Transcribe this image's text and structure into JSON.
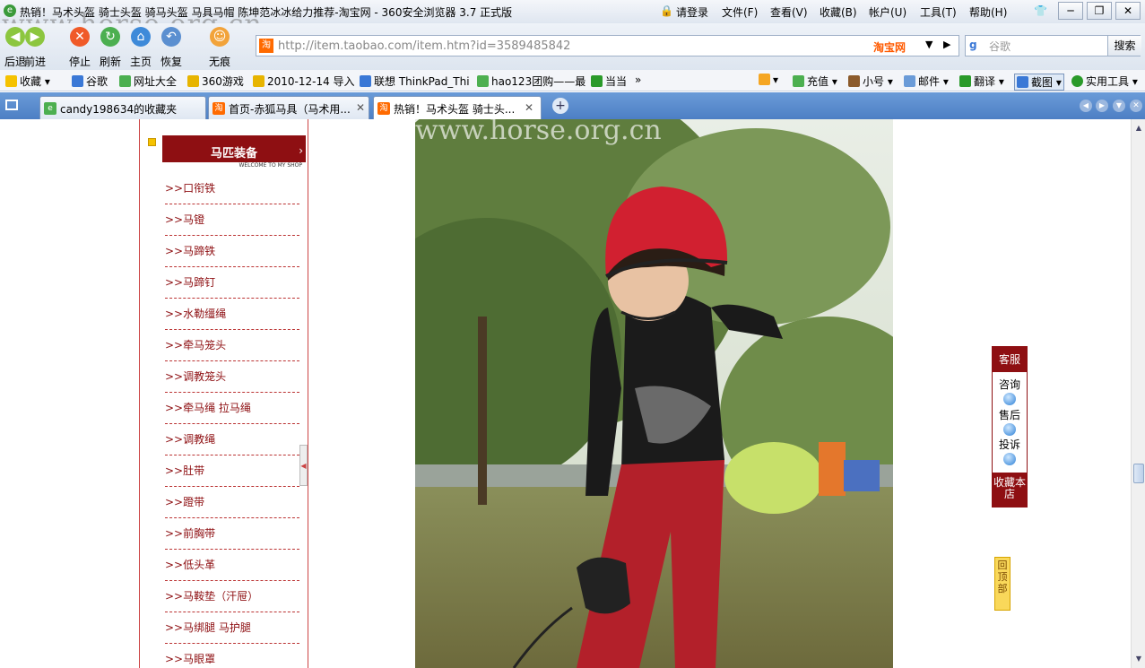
{
  "window": {
    "title": "热销！马术头盔 骑士头盔 骑马头盔 马具马帽 陈坤范冰冰给力推荐-淘宝网 - 360安全浏览器 3.7 正式版",
    "watermark": "www.horse.org.cn",
    "menu": [
      "请登录",
      "文件(F)",
      "查看(V)",
      "收藏(B)",
      "帐户(U)",
      "工具(T)",
      "帮助(H)"
    ]
  },
  "toolbar": {
    "buttons": [
      "后退",
      "前进",
      "停止",
      "刷新",
      "主页",
      "恢复",
      "无痕"
    ],
    "address": "http://item.taobao.com/item.htm?id=3589485842",
    "address_brand": "淘宝网",
    "search_placeholder": "谷歌",
    "search_button": "搜索"
  },
  "bookmarks": [
    "收藏",
    "谷歌",
    "网址大全",
    "360游戏",
    "2010-12-14 导入",
    "联想 ThinkPad_Thi",
    "hao123团购——最",
    "当当"
  ],
  "bookmarks_right": [
    "充值",
    "小号",
    "邮件",
    "翻译",
    "截图",
    "实用工具"
  ],
  "tabs": [
    {
      "label": "candy198634的收藏夹",
      "active": false
    },
    {
      "label": "首页-赤狐马具（马术用...",
      "active": false
    },
    {
      "label": "热销！马术头盔 骑士头...",
      "active": true
    }
  ],
  "sidebar": {
    "header_title": "马匹装备",
    "header_sub": "WELCOME TO MY SHOP",
    "items": [
      "口衔铁",
      "马镫",
      "马蹄铁",
      "马蹄钉",
      "水勒缰绳",
      "牵马笼头",
      "调教笼头",
      "牵马绳 拉马绳",
      "调教绳",
      "肚带",
      "蹬带",
      "前胸带",
      "低头革",
      "马鞍垫（汗屉）",
      "马绑腿 马护腿",
      "马眼罩"
    ],
    "item_prefix": ">>"
  },
  "photo": {
    "watermark": "www.horse.org.cn"
  },
  "service": {
    "head": "客服",
    "items": [
      "咨询",
      "售后",
      "投诉"
    ],
    "fav": "收藏本店"
  },
  "totop": "回顶部",
  "colors": {
    "accent": "#8e0f12",
    "tabbar": "#4d7fc4",
    "brand": "#ff5a00"
  }
}
